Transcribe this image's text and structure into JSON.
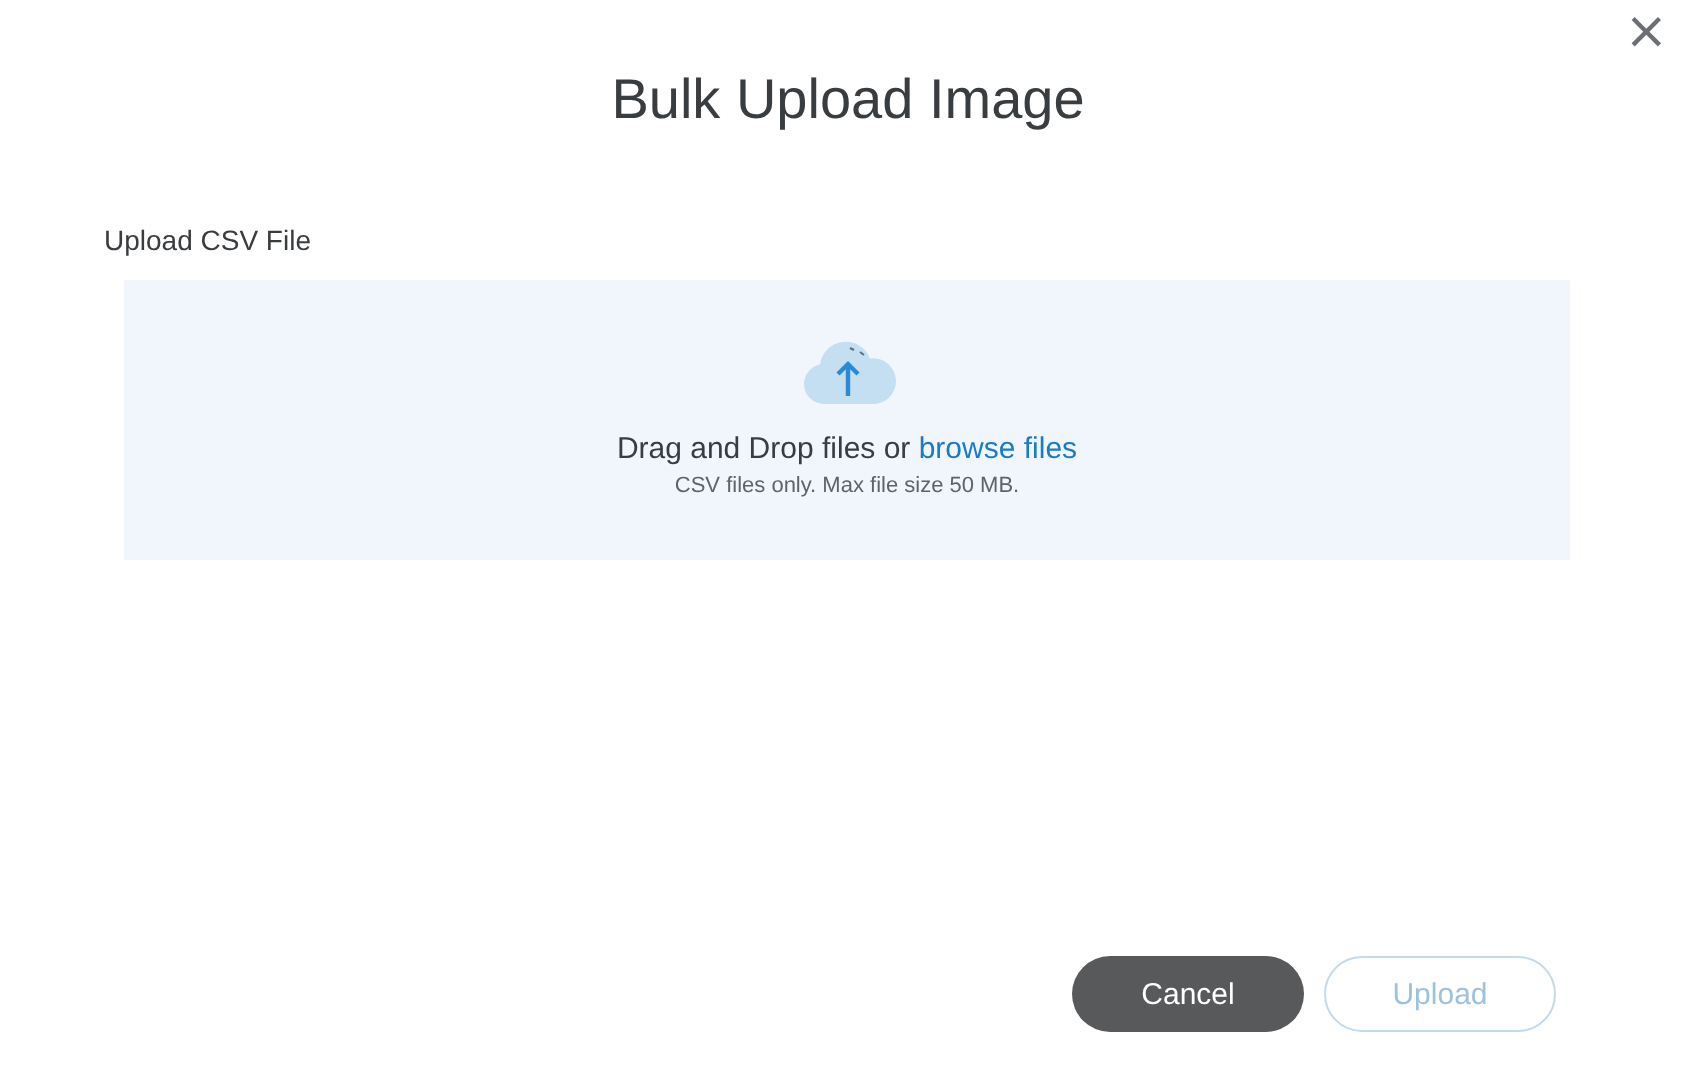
{
  "dialog": {
    "title": "Bulk Upload Image",
    "close": "×"
  },
  "upload": {
    "label": "Upload CSV File",
    "prompt": "Drag and Drop files or",
    "link": "browse files",
    "hint": "CSV files only. Max file size 50 MB."
  },
  "buttons": [
    {
      "label": "Cancel",
      "kind": "secondary",
      "disabled": false
    },
    {
      "label": "Upload",
      "kind": "primary",
      "disabled": true
    }
  ]
}
